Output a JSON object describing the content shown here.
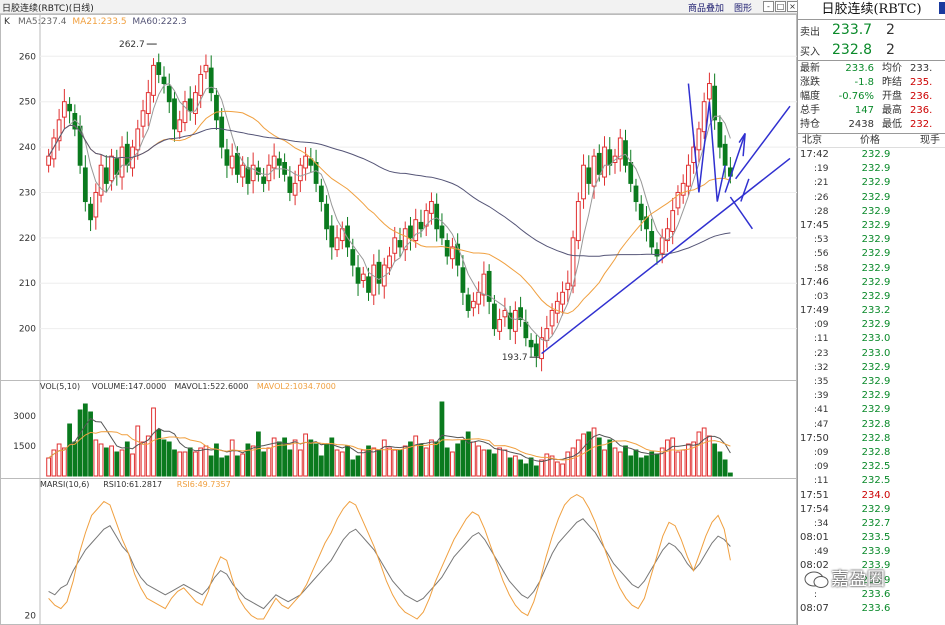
{
  "topbar": {
    "title": "日胶连续(RBTC)(日线)",
    "btn_add": "商品叠加",
    "btn_icon": "图形",
    "win_buttons": [
      "-",
      "□",
      "×"
    ]
  },
  "panel": {
    "title": "日胶连续(RBTC)",
    "sell_label": "卖出",
    "sell_price": "233.7",
    "sell_qty": "2",
    "buy_label": "买入",
    "buy_price": "232.8",
    "buy_qty": "2",
    "stats": [
      {
        "l1": "最新",
        "v1": "233.6",
        "l2": "均价",
        "v2": "233."
      },
      {
        "l1": "涨跌",
        "v1": "-1.8",
        "l2": "昨结",
        "v2": "235."
      },
      {
        "l1": "幅度",
        "v1": "-0.76%",
        "l2": "开盘",
        "v2": "236."
      },
      {
        "l1": "总手",
        "v1": "147",
        "l2": "最高",
        "v2": "236."
      },
      {
        "l1": "持仓",
        "v1": "2438",
        "l2": "最低",
        "v2": "232."
      }
    ],
    "tick_header": [
      "北京",
      "价格",
      "现手"
    ],
    "ticks": [
      {
        "t": "17:42",
        "p": "232.9",
        "major": true
      },
      {
        "t": ":19",
        "p": "232.9",
        "major": false
      },
      {
        "t": ":21",
        "p": "232.9",
        "major": false
      },
      {
        "t": ":26",
        "p": "232.9",
        "major": false
      },
      {
        "t": ":28",
        "p": "232.9",
        "major": false
      },
      {
        "t": "17:45",
        "p": "232.9",
        "major": true
      },
      {
        "t": ":53",
        "p": "232.9",
        "major": false
      },
      {
        "t": ":56",
        "p": "232.9",
        "major": false
      },
      {
        "t": ":58",
        "p": "232.9",
        "major": false
      },
      {
        "t": "17:46",
        "p": "232.9",
        "major": true
      },
      {
        "t": ":03",
        "p": "232.9",
        "major": false
      },
      {
        "t": "17:49",
        "p": "233.2",
        "major": true
      },
      {
        "t": ":09",
        "p": "232.9",
        "major": false
      },
      {
        "t": ":11",
        "p": "233.0",
        "major": false
      },
      {
        "t": ":23",
        "p": "233.0",
        "major": false
      },
      {
        "t": ":32",
        "p": "232.9",
        "major": false
      },
      {
        "t": ":35",
        "p": "232.9",
        "major": false
      },
      {
        "t": ":39",
        "p": "232.9",
        "major": false
      },
      {
        "t": ":41",
        "p": "232.9",
        "major": false
      },
      {
        "t": ":47",
        "p": "232.8",
        "major": false
      },
      {
        "t": "17:50",
        "p": "232.8",
        "major": true
      },
      {
        "t": ":09",
        "p": "232.8",
        "major": false
      },
      {
        "t": ":09",
        "p": "232.5",
        "major": false
      },
      {
        "t": ":11",
        "p": "232.5",
        "major": false
      },
      {
        "t": "17:51",
        "p": "234.0",
        "major": true
      },
      {
        "t": "17:54",
        "p": "232.9",
        "major": true
      },
      {
        "t": ":34",
        "p": "232.7",
        "major": false
      },
      {
        "t": "08:01",
        "p": "233.5",
        "major": true
      },
      {
        "t": ":49",
        "p": "233.9",
        "major": false
      },
      {
        "t": "08:02",
        "p": "233.9",
        "major": true
      },
      {
        "t": ":",
        "p": "233.9",
        "major": false
      },
      {
        "t": ":",
        "p": "233.6",
        "major": false
      },
      {
        "t": "08:07",
        "p": "233.6",
        "major": true
      }
    ]
  },
  "watermark": "嘉盈圈",
  "colors": {
    "up": "#e03030",
    "down": "#0a7a1e",
    "ma5": "#999999",
    "ma21": "#f0a040",
    "ma60": "#555577",
    "trend": "#3030d0"
  },
  "chart_data": [
    {
      "type": "candlestick",
      "title": "",
      "legend": [
        "K",
        "MA5:237.4",
        "MA21:233.5",
        "MA60:222.3"
      ],
      "ylim": [
        190,
        268
      ],
      "yticks": [
        200,
        210,
        220,
        230,
        240,
        250,
        260
      ],
      "annotations": [
        {
          "text": "262.7",
          "bar": 21,
          "value": 262.7
        },
        {
          "text": "193.7",
          "bar": 94,
          "value": 193.7
        }
      ],
      "closes": [
        238,
        242,
        246,
        250,
        248,
        244,
        236,
        228,
        224,
        230,
        236,
        232,
        238,
        234,
        240,
        236,
        240,
        244,
        248,
        252,
        258,
        256,
        254,
        250,
        244,
        246,
        250,
        248,
        252,
        256,
        258,
        252,
        246,
        240,
        236,
        238,
        234,
        236,
        232,
        236,
        234,
        232,
        236,
        238,
        236,
        234,
        230,
        232,
        236,
        238,
        236,
        232,
        228,
        222,
        218,
        220,
        222,
        218,
        214,
        210,
        212,
        208,
        214,
        210,
        214,
        216,
        220,
        218,
        222,
        220,
        224,
        222,
        226,
        228,
        222,
        220,
        216,
        218,
        214,
        208,
        204,
        206,
        208,
        212,
        206,
        200,
        202,
        204,
        200,
        204,
        202,
        198,
        196,
        194,
        198,
        200,
        204,
        206,
        208,
        210,
        220,
        228,
        236,
        232,
        238,
        234,
        240,
        236,
        238,
        242,
        236,
        232,
        228,
        224,
        222,
        218,
        216,
        220,
        222,
        226,
        230,
        232,
        236,
        240,
        244,
        250,
        254,
        246,
        240,
        236,
        233.6
      ]
    },
    {
      "type": "bar",
      "title": "",
      "legend": [
        "VOL(5,10)",
        "VOLUME:147.0000",
        "MAVOL1:522.6000",
        "MAVOL2:1034.7000"
      ],
      "yticks": [
        1500,
        3000
      ],
      "values": [
        900,
        1300,
        1600,
        1400,
        2600,
        1700,
        3300,
        3600,
        3200,
        1800,
        1600,
        1400,
        1500,
        1200,
        1300,
        1700,
        1100,
        2500,
        1700,
        2000,
        3400,
        2300,
        1800,
        1700,
        1300,
        1200,
        1200,
        1400,
        1200,
        1400,
        1500,
        1000,
        1600,
        900,
        1000,
        1800,
        1000,
        1100,
        1600,
        1500,
        2200,
        1200,
        1400,
        1900,
        1700,
        1900,
        1300,
        1800,
        1300,
        2100,
        1800,
        1600,
        1000,
        1600,
        1900,
        1300,
        1200,
        1500,
        800,
        1000,
        1300,
        1500,
        1400,
        1300,
        1800,
        1400,
        1300,
        1300,
        1500,
        1700,
        2000,
        1600,
        1400,
        1800,
        1700,
        3700,
        1400,
        1200,
        1600,
        1800,
        2200,
        1700,
        1500,
        1300,
        1300,
        1100,
        1400,
        1300,
        900,
        1000,
        800,
        600,
        900,
        500,
        800,
        1100,
        1000,
        700,
        600,
        1200,
        1400,
        1800,
        2100,
        2200,
        2400,
        1900,
        1300,
        1800,
        1400,
        1200,
        1500,
        1000,
        1300,
        900,
        1000,
        1200,
        1100,
        1400,
        1800,
        1900,
        1200,
        1300,
        1600,
        1700,
        2200,
        2400,
        2000,
        1600,
        1200,
        800,
        147
      ]
    },
    {
      "type": "line",
      "title": "",
      "legend": [
        "MARSI(10,6)",
        "RSI10:61.2817",
        "RSI6:49.7357"
      ],
      "yticks": [
        20
      ],
      "series": [
        {
          "name": "RSI10",
          "values": [
            34,
            32,
            36,
            38,
            46,
            52,
            58,
            62,
            66,
            70,
            72,
            66,
            60,
            56,
            48,
            42,
            38,
            36,
            34,
            32,
            34,
            36,
            38,
            36,
            34,
            32,
            36,
            42,
            46,
            44,
            38,
            34,
            30,
            28,
            26,
            24,
            28,
            32,
            30,
            28,
            30,
            32,
            36,
            40,
            44,
            48,
            52,
            58,
            64,
            68,
            70,
            66,
            62,
            58,
            52,
            46,
            40,
            36,
            32,
            30,
            28,
            30,
            34,
            38,
            42,
            48,
            54,
            58,
            62,
            66,
            68,
            64,
            58,
            52,
            46,
            40,
            36,
            32,
            30,
            34,
            40,
            48,
            56,
            62,
            66,
            70,
            74,
            76,
            72,
            68,
            62,
            56,
            50,
            46,
            42,
            38,
            36,
            40,
            46,
            52,
            58,
            62,
            60,
            56,
            50,
            46,
            50,
            56,
            62,
            66,
            64,
            60
          ]
        },
        {
          "name": "RSI6",
          "values": [
            30,
            26,
            24,
            28,
            40,
            56,
            68,
            78,
            82,
            86,
            84,
            74,
            64,
            56,
            44,
            36,
            30,
            28,
            26,
            24,
            30,
            34,
            36,
            32,
            28,
            26,
            34,
            46,
            54,
            52,
            40,
            30,
            24,
            20,
            18,
            18,
            24,
            30,
            26,
            24,
            28,
            32,
            38,
            46,
            54,
            62,
            68,
            76,
            82,
            86,
            84,
            76,
            68,
            60,
            50,
            40,
            32,
            26,
            22,
            20,
            18,
            22,
            30,
            40,
            48,
            56,
            64,
            70,
            76,
            80,
            78,
            70,
            60,
            50,
            40,
            32,
            26,
            22,
            20,
            28,
            40,
            54,
            66,
            76,
            84,
            88,
            90,
            88,
            82,
            74,
            64,
            54,
            44,
            36,
            30,
            26,
            24,
            30,
            42,
            54,
            66,
            74,
            72,
            64,
            54,
            46,
            56,
            66,
            74,
            78,
            70,
            52
          ]
        }
      ]
    }
  ]
}
